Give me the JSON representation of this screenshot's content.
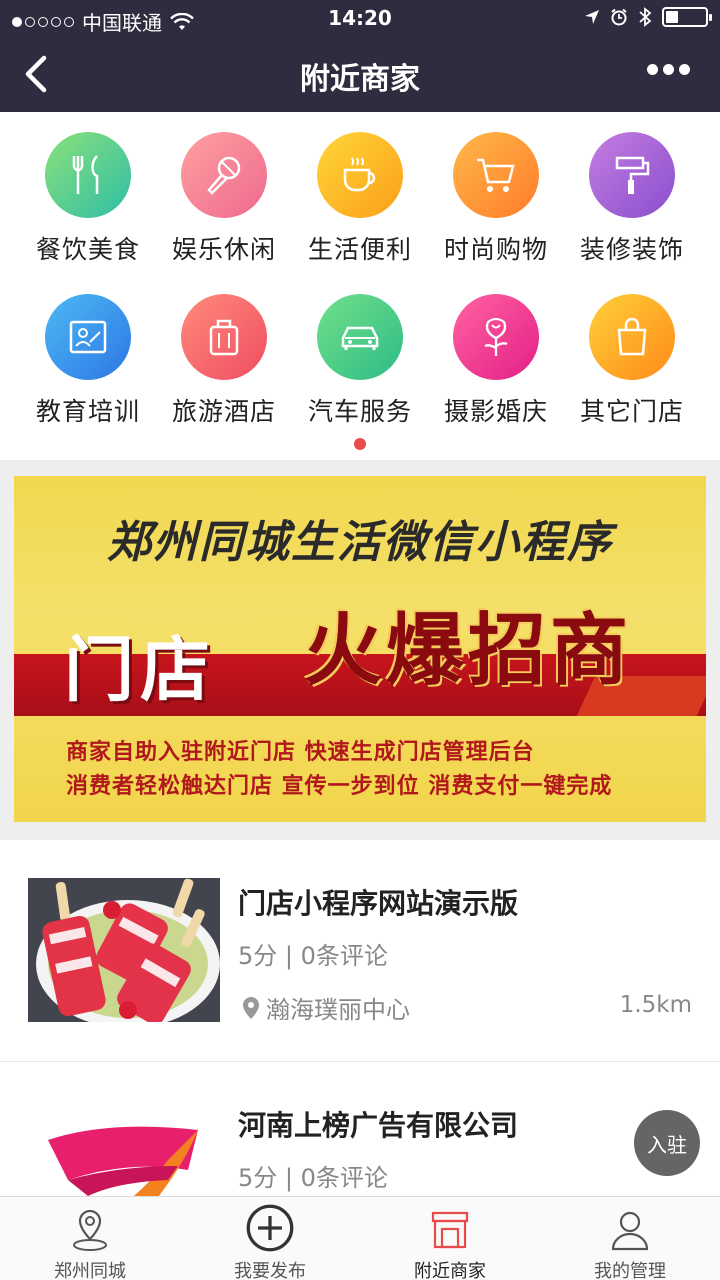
{
  "status_bar": {
    "carrier": "中国联通",
    "time": "14:20"
  },
  "nav": {
    "title": "附近商家"
  },
  "categories": [
    {
      "label": "餐饮美食",
      "icon": "cutlery-icon",
      "color_from": "#7ee07a",
      "color_to": "#2fc0a0"
    },
    {
      "label": "娱乐休闲",
      "icon": "microphone-icon",
      "color_from": "#ff9a9a",
      "color_to": "#f06c8c"
    },
    {
      "label": "生活便利",
      "icon": "coffee-cup-icon",
      "color_from": "#ffd23c",
      "color_to": "#fba11a"
    },
    {
      "label": "时尚购物",
      "icon": "shopping-cart-icon",
      "color_from": "#ffb347",
      "color_to": "#ff7a2c"
    },
    {
      "label": "装修装饰",
      "icon": "paint-roller-icon",
      "color_from": "#c07ce0",
      "color_to": "#8c4fd0"
    },
    {
      "label": "教育培训",
      "icon": "classroom-icon",
      "color_from": "#4ab8f2",
      "color_to": "#2f79e6"
    },
    {
      "label": "旅游酒店",
      "icon": "suitcase-icon",
      "color_from": "#ff8a7a",
      "color_to": "#f24f62"
    },
    {
      "label": "汽车服务",
      "icon": "car-icon",
      "color_from": "#6ee08a",
      "color_to": "#2fc08a"
    },
    {
      "label": "摄影婚庆",
      "icon": "rose-icon",
      "color_from": "#ff5f9a",
      "color_to": "#e8208a"
    },
    {
      "label": "其它门店",
      "icon": "shopping-bag-icon",
      "color_from": "#ffcc3a",
      "color_to": "#ff8c1a"
    }
  ],
  "banner": {
    "title": "郑州同城生活微信小程序",
    "store_text": "门店",
    "hot_text": "火爆招商",
    "line1": "商家自助入驻附近门店   快速生成门店管理后台",
    "line2": "消费者轻松触达门店  宣传一步到位  消费支付一键完成"
  },
  "merchants": [
    {
      "name": "门店小程序网站演示版",
      "meta": "5分 | 0条评论",
      "address": "瀚海璞丽中心",
      "distance": "1.5km"
    },
    {
      "name": "河南上榜广告有限公司",
      "meta": "5分 | 0条评论"
    }
  ],
  "join_button": "入驻",
  "tabs": [
    {
      "label": "郑州同城",
      "icon": "location-pin-icon"
    },
    {
      "label": "我要发布",
      "icon": "plus-circle-icon"
    },
    {
      "label": "附近商家",
      "icon": "store-icon",
      "active": true
    },
    {
      "label": "我的管理",
      "icon": "user-icon"
    }
  ],
  "colors": {
    "header_bg": "#2f2c3f",
    "accent_red": "#e94b4b",
    "tab_active": "#e94b4b"
  }
}
